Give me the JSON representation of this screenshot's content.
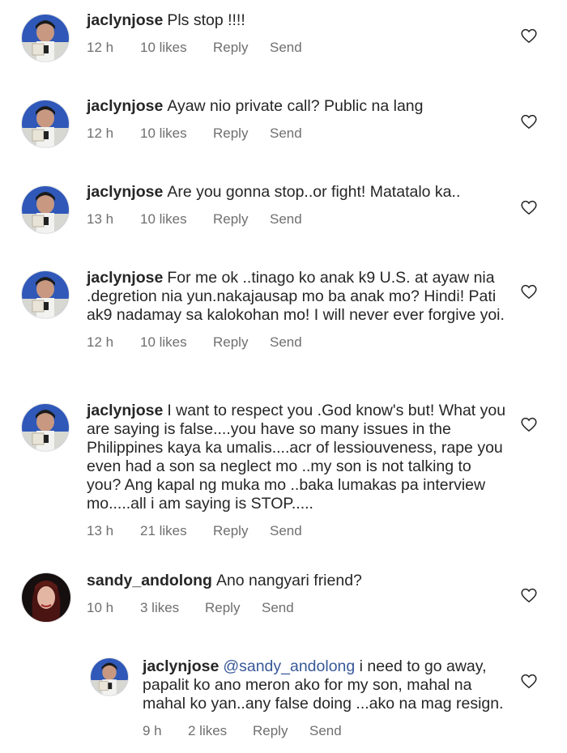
{
  "comments": [
    {
      "user": "jaclynjose",
      "text": "Pls stop !!!!",
      "time": "12 h",
      "likes": "10 likes",
      "reply": "Reply",
      "send": "Send"
    },
    {
      "user": "jaclynjose",
      "text": "Ayaw nio private call? Public na lang",
      "time": "12 h",
      "likes": "10 likes",
      "reply": "Reply",
      "send": "Send"
    },
    {
      "user": "jaclynjose",
      "text": "Are you gonna stop..or fight! Matatalo ka..",
      "time": "13 h",
      "likes": "10 likes",
      "reply": "Reply",
      "send": "Send"
    },
    {
      "user": "jaclynjose",
      "text": "For me ok ..tinago ko anak k9 U.S.  at ayaw nia .degretion nia yun.nakajausap mo ba anak mo? Hindi! Pati ak9 nadamay sa kalokohan mo! I will never ever forgive yoi.",
      "time": "12 h",
      "likes": "10 likes",
      "reply": "Reply",
      "send": "Send"
    },
    {
      "user": "jaclynjose",
      "text": "I want to respect you .God know's but! What you are saying is false....you have so many issues in the Philippines kaya ka umalis....acr of lessiouveness, rape you even had a son sa neglect mo ..my son is not talking to you? Ang kapal ng muka mo ..baka lumakas pa interview mo.....all i am saying is STOP.....",
      "time": "13 h",
      "likes": "21 likes",
      "reply": "Reply",
      "send": "Send"
    },
    {
      "user": "sandy_andolong",
      "text": "Ano nangyari friend?",
      "time": "10 h",
      "likes": "3 likes",
      "reply": "Reply",
      "send": "Send"
    }
  ],
  "reply": {
    "user": "jaclynjose",
    "mention": "@sandy_andolong",
    "text": "i need to go away, papalit ko ano meron ako for my son, mahal na mahal ko yan..any false doing ...ako na mag resign.",
    "time": "9 h",
    "likes": "2 likes",
    "reply": "Reply",
    "send": "Send"
  },
  "colors": {
    "text": "#262626",
    "meta": "#6f6f6f",
    "mention": "#385898"
  },
  "icons": {
    "like": "heart-outline-icon"
  }
}
